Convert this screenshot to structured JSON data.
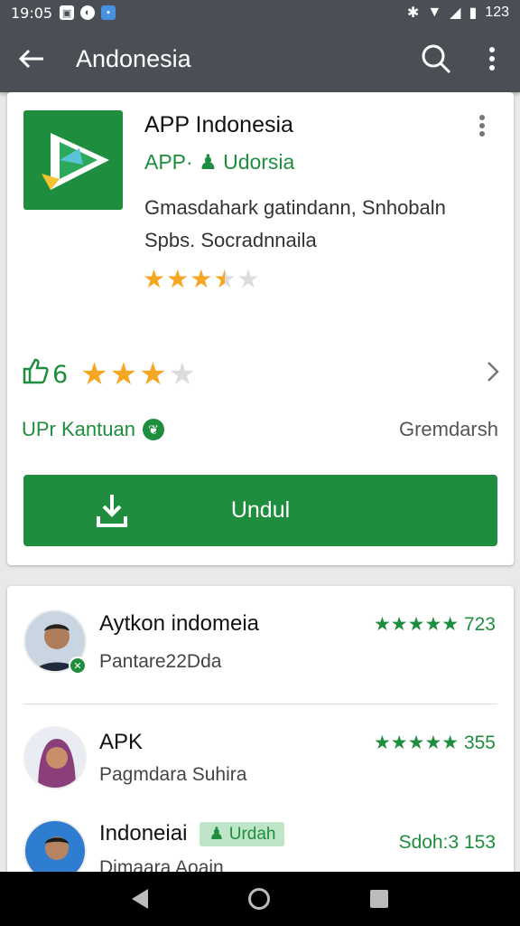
{
  "status_bar": {
    "time": "19:05",
    "battery": "123"
  },
  "app_bar": {
    "title": "Andonesia"
  },
  "app": {
    "name": "APP Indonesia",
    "developer": "APP· ♟ Udorsia",
    "description_line1": "Gmasdahark gatindann, Snhobaln",
    "description_line2": "Spbs. Socradnnaila",
    "rating_small": 3.5
  },
  "rating_row": {
    "number": "6",
    "rating": 3
  },
  "meta": {
    "left": "UPr Kantuan",
    "right": "Gremdarsh"
  },
  "install": {
    "label": "Undul"
  },
  "list": [
    {
      "title": "Aytkon indomeia",
      "sub": "Pantare22Dda",
      "rate": "★★★★★ 723"
    },
    {
      "title": "APK",
      "sub": "Pagmdara Suhira",
      "rate": "★★★★★ 355"
    },
    {
      "title": "Indoneiai",
      "tag": "♟ Urdah",
      "sub": "Dimaara Aoain",
      "rate": "Sdoh:3 153"
    }
  ],
  "colors": {
    "primary": "#1e8e3e",
    "bar": "#4a4f55",
    "star": "#f5a623"
  }
}
